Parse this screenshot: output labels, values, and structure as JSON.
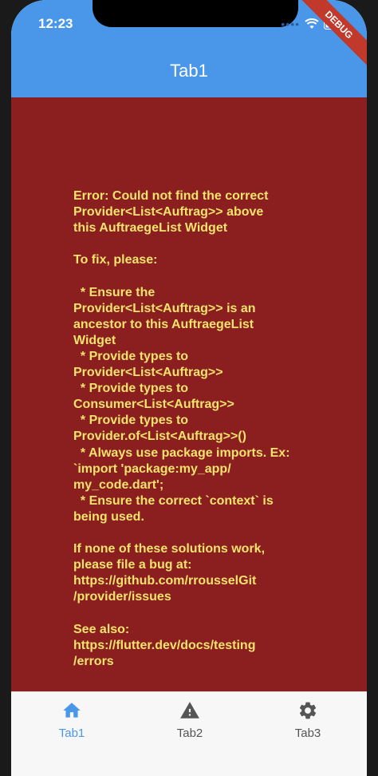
{
  "status_bar": {
    "time": "12:23"
  },
  "app_bar": {
    "title": "Tab1"
  },
  "debug_banner": "DEBUG",
  "error_message": "Error: Could not find the correct\nProvider<List<Auftrag>> above\nthis AuftraegeList Widget\n\nTo fix, please:\n\n  * Ensure the\nProvider<List<Auftrag>> is an\nancestor to this AuftraegeList\nWidget\n  * Provide types to\nProvider<List<Auftrag>>\n  * Provide types to\nConsumer<List<Auftrag>>\n  * Provide types to\nProvider.of<List<Auftrag>>()\n  * Always use package imports. Ex:\n`import 'package:my_app/\nmy_code.dart';\n  * Ensure the correct `context` is\nbeing used.\n\nIf none of these solutions work,\nplease file a bug at:\nhttps://github.com/rrousselGit\n/provider/issues\n\nSee also:\nhttps://flutter.dev/docs/testing\n/errors",
  "bottom_nav": {
    "tabs": [
      {
        "label": "Tab1",
        "icon": "home-icon",
        "active": true
      },
      {
        "label": "Tab2",
        "icon": "warning-icon",
        "active": false
      },
      {
        "label": "Tab3",
        "icon": "gear-icon",
        "active": false
      }
    ]
  },
  "colors": {
    "app_bar": "#4a97ea",
    "error_background": "#8b1f1f",
    "error_text": "#f5e36d",
    "active_tab": "#4a97ea",
    "inactive_tab": "#555555"
  }
}
